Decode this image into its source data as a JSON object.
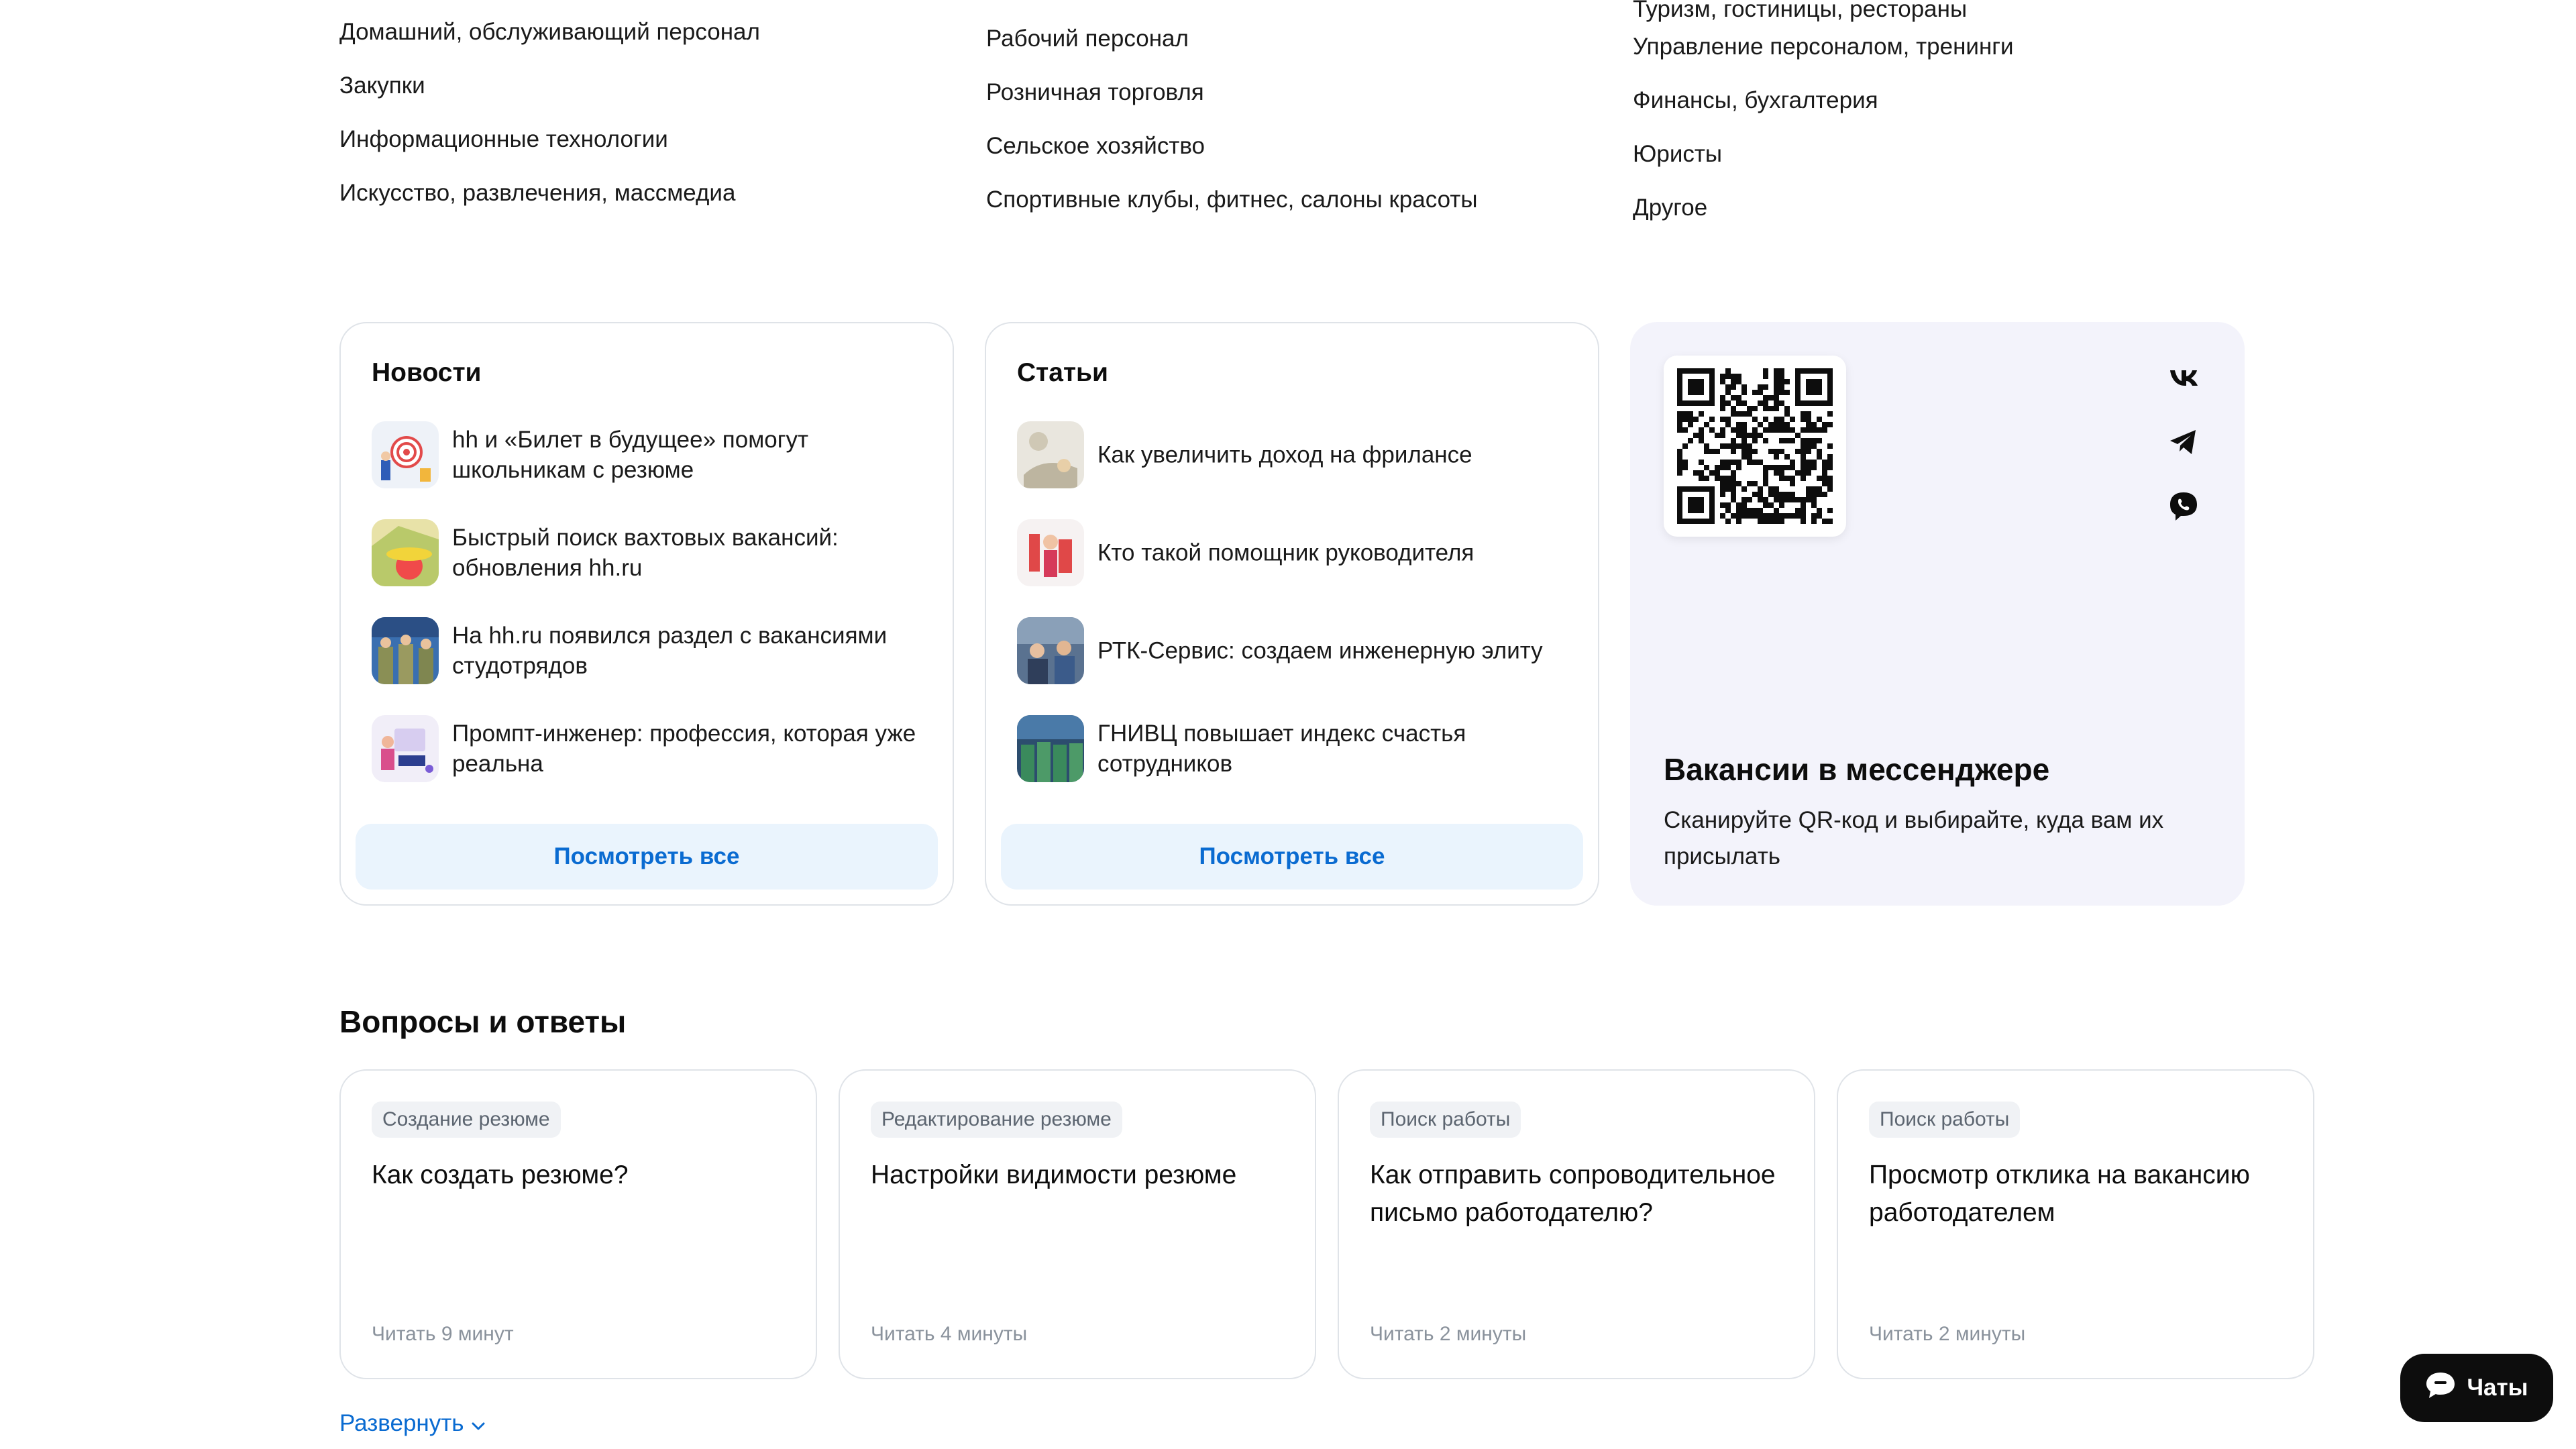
{
  "categories": {
    "col1": [
      "Домашний, обслуживающий персонал",
      "Закупки",
      "Информационные технологии",
      "Искусство, развлечения, массмедиа"
    ],
    "col2": [
      "Рабочий персонал",
      "Розничная торговля",
      "Сельское хозяйство",
      "Спортивные клубы, фитнес, салоны красоты"
    ],
    "col3_clipped": "Туризм, гостиницы, рестораны",
    "col3": [
      "Управление персоналом, тренинги",
      "Финансы, бухгалтерия",
      "Юристы",
      "Другое"
    ]
  },
  "news": {
    "title": "Новости",
    "items": [
      "hh и «Билет в будущее» помогут школьникам с резюме",
      "Быстрый поиск вахтовых вакансий: обновления hh.ru",
      "На hh.ru появился раздел с вакансиями студотрядов",
      "Промпт-инженер: профессия, которая уже реальна"
    ],
    "see_all": "Посмотреть все"
  },
  "articles": {
    "title": "Статьи",
    "items": [
      "Как увеличить доход на фрилансе",
      "Кто такой помощник руководителя",
      "РТК-Сервис: создаем инженерную элиту",
      "ГНИВЦ повышает индекс счастья сотрудников"
    ],
    "see_all": "Посмотреть все"
  },
  "messenger": {
    "title": "Вакансии в мессенджере",
    "subtitle": "Сканируйте QR-код и выбирайте, куда вам их присылать",
    "icons": [
      "vk-icon",
      "telegram-icon",
      "viber-icon"
    ]
  },
  "faq": {
    "title": "Вопросы и ответы",
    "cards": [
      {
        "tag": "Создание резюме",
        "question": "Как создать резюме?",
        "time": "Читать 9 минут"
      },
      {
        "tag": "Редактирование резюме",
        "question": "Настройки видимости резюме",
        "time": "Читать 4 минуты"
      },
      {
        "tag": "Поиск работы",
        "question": "Как отправить сопроводительное письмо работодателю?",
        "time": "Читать 2 минуты"
      },
      {
        "tag": "Поиск работы",
        "question": "Просмотр отклика на вакансию работодателем",
        "time": "Читать 2 минуты"
      }
    ],
    "expand": "Развернуть"
  },
  "chat": {
    "label": "Чаты"
  },
  "colors": {
    "accent": "#0a6bd1",
    "button_bg": "#eaf4fd",
    "messenger_bg": "#f3f3fb",
    "chat_bg": "#0d0d0d"
  }
}
